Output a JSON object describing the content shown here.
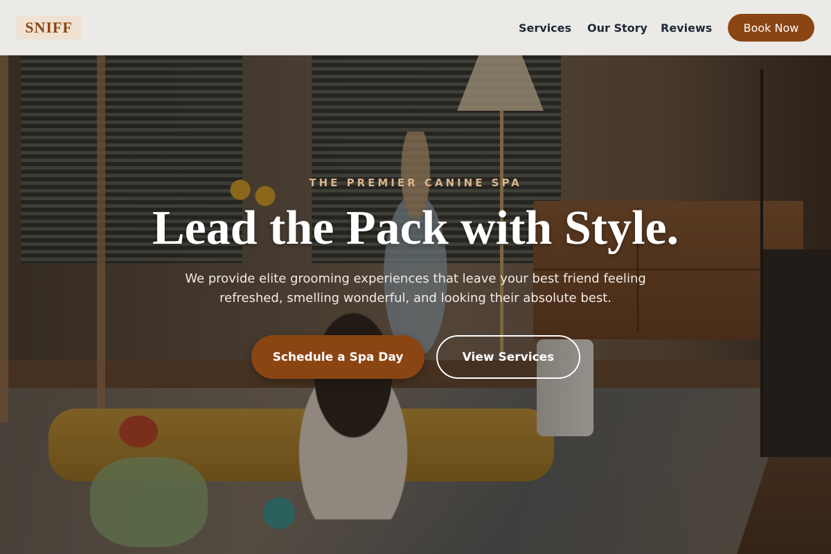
{
  "brand": {
    "logo_text": "SNIFF"
  },
  "nav": {
    "items": [
      {
        "label": "Services"
      },
      {
        "label": "Our Story"
      },
      {
        "label": "Reviews"
      }
    ],
    "cta_label": "Book Now"
  },
  "hero": {
    "eyebrow": "THE PREMIER CANINE SPA",
    "headline": "Lead the Pack with Style.",
    "subtext": "We provide elite grooming experiences that leave your best friend feeling refreshed, smelling wonderful, and looking their absolute best.",
    "primary_cta": "Schedule a Spa Day",
    "secondary_cta": "View Services"
  },
  "colors": {
    "accent": "#8b4513",
    "eyebrow": "#d9b48e",
    "header_bg": "#f2f1ef",
    "logo_bg": "#f0e2d2"
  }
}
